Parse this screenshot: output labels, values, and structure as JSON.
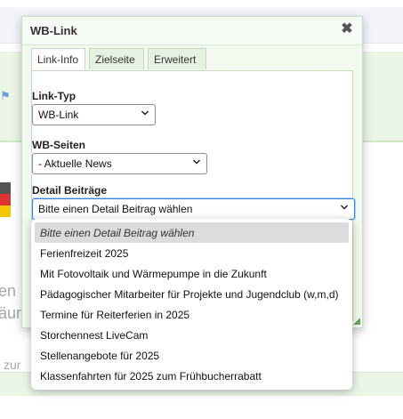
{
  "background": {
    "text_fragments": [
      "en u",
      "äur",
      "zur"
    ]
  },
  "dialog": {
    "title": "WB-Link",
    "close_icon": "close-icon",
    "tabs": [
      {
        "label": "Link-Info",
        "active": true
      },
      {
        "label": "Zielseite",
        "active": false
      },
      {
        "label": "Erweitert",
        "active": false
      }
    ],
    "fields": {
      "link_typ": {
        "label": "Link-Typ",
        "value": "WB-Link"
      },
      "wb_seiten": {
        "label": "WB-Seiten",
        "value": "- Aktuelle News"
      },
      "detail_beitraege": {
        "label": "Detail Beiträge",
        "value": "Bitte einen Detail Beitrag wählen"
      }
    }
  },
  "dropdown": {
    "options": [
      {
        "label": "Bitte einen Detail Beitrag wählen",
        "selected": true
      },
      {
        "label": "Ferienfreizeit 2025",
        "selected": false
      },
      {
        "label": "Mit Fotovoltaik und Wärmepumpe in die Zukunft",
        "selected": false
      },
      {
        "label": "Pädagogischer Mitarbeiter für Projekte und Jugendclub (w,m,d)",
        "selected": false
      },
      {
        "label": "Termine für Reiterferien in 2025",
        "selected": false
      },
      {
        "label": "Storchennest LiveCam",
        "selected": false
      },
      {
        "label": "Stellenangebote für 2025",
        "selected": false
      },
      {
        "label": "Klassenfahrten für 2025 zum Frühbucherrabatt",
        "selected": false
      }
    ]
  },
  "colors": {
    "accent": "#3b7fd1",
    "dialog_bg": "#f2f9ef",
    "selected_option_bg": "#dcdcdc"
  }
}
